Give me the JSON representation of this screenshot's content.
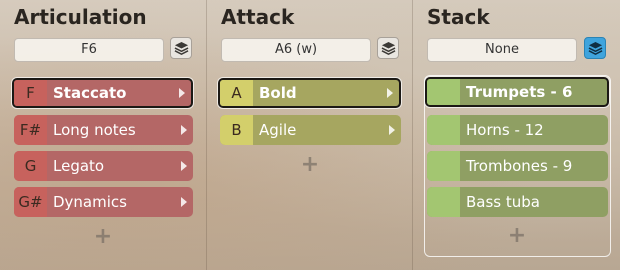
{
  "colors": {
    "articulation_key": "#c7625d",
    "articulation_row": "#b46766",
    "attack_key": "#d3cf6b",
    "attack_row": "#a6a660",
    "stack_key": "#a3c671",
    "stack_row": "#8f9f63",
    "stack_button_active": "#3fa4dd"
  },
  "articulation": {
    "title": "Articulation",
    "preset": "F6",
    "stack_icon": "layers-icon",
    "items": [
      {
        "key": "F",
        "label": "Staccato",
        "selected": true
      },
      {
        "key": "F#",
        "label": "Long notes",
        "selected": false
      },
      {
        "key": "G",
        "label": "Legato",
        "selected": false
      },
      {
        "key": "G#",
        "label": "Dynamics",
        "selected": false
      }
    ],
    "add_label": "+"
  },
  "attack": {
    "title": "Attack",
    "preset": "A6 (w)",
    "stack_icon": "layers-icon",
    "items": [
      {
        "key": "A",
        "label": "Bold",
        "selected": true
      },
      {
        "key": "B",
        "label": "Agile",
        "selected": false
      }
    ],
    "add_label": "+"
  },
  "stack": {
    "title": "Stack",
    "preset": "None",
    "stack_icon": "layers-icon",
    "stack_active": true,
    "items": [
      {
        "label": "Trumpets - 6",
        "selected": true
      },
      {
        "label": "Horns - 12",
        "selected": false
      },
      {
        "label": "Trombones - 9",
        "selected": false
      },
      {
        "label": "Bass tuba",
        "selected": false
      }
    ],
    "add_label": "+"
  }
}
